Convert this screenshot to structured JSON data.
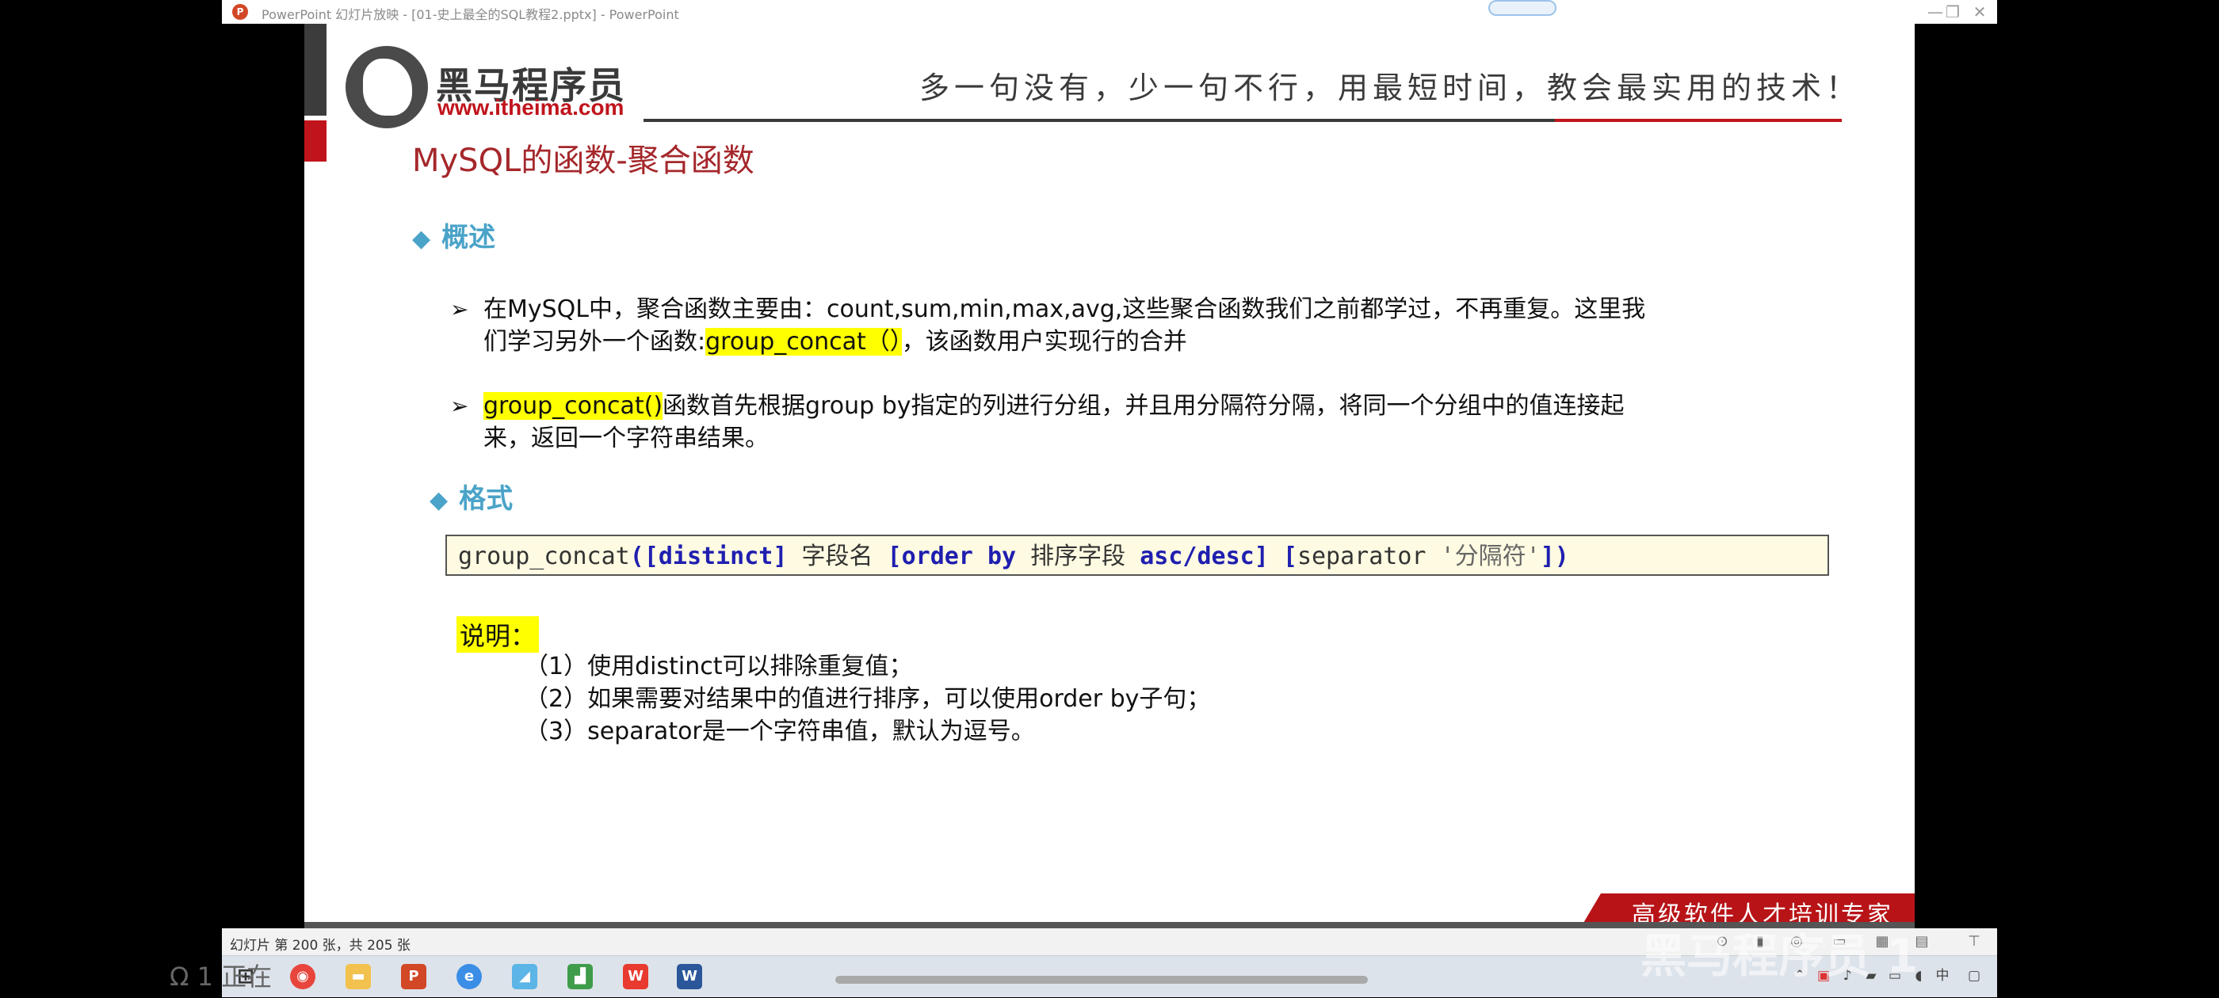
{
  "window": {
    "app_icon_letter": "P",
    "title": "PowerPoint 幻灯片放映 - [01-史上最全的SQL教程2.pptx] - PowerPoint",
    "minimize": "—",
    "restore": "❐",
    "close": "✕"
  },
  "slide": {
    "logo": {
      "name": "黑马程序员",
      "url": "www.itheima.com"
    },
    "slogan": "多一句没有，少一句不行，用最短时间，教会最实用的技术！",
    "title": "MySQL的函数-聚合函数",
    "overview": {
      "diamond": "◆",
      "heading": "概述",
      "bullets": [
        {
          "arrow": "➢",
          "line1": "在MySQL中，聚合函数主要由：count,sum,min,max,avg,这些聚合函数我们之前都学过，不再重复。这里我",
          "line2_prefix": "们学习另外一个函数:",
          "line2_highlight": "group_concat（）",
          "line2_suffix": "，该函数用户实现行的合并"
        },
        {
          "arrow": "➢",
          "highlight": "group_concat()",
          "line1_suffix": "函数首先根据group by指定的列进行分组，并且用分隔符分隔，将同一个分组中的值连接起",
          "line2": "来，返回一个字符串结果。"
        }
      ]
    },
    "format": {
      "diamond": "◆",
      "heading": "格式",
      "code": {
        "fn": "group_concat",
        "open": "([",
        "distinct": "distinct",
        "close1": "]",
        "field": " 字段名 ",
        "lb": "[",
        "order_by": "order by",
        "sort_field": " 排序字段 ",
        "asc_desc": "asc/desc",
        "close2": "]",
        "lb2": "[",
        "separator": "separator ",
        "sep_value": "'分隔符'",
        "end": "])"
      }
    },
    "notes": {
      "label": "说明：",
      "items": [
        "（1）使用distinct可以排除重复值；",
        "（2）如果需要对结果中的值进行排序，可以使用order by子句；",
        "（3）separator是一个字符串值，默认为逗号。"
      ]
    },
    "banner": "高级软件人才培训专家"
  },
  "statusbar": {
    "slide_info": "幻灯片 第 200 张，共 205 张"
  },
  "overlay": {
    "left_text": "Ω 1  正在",
    "right_text": "黑马程序员 1"
  },
  "colors": {
    "title_red": "#a5272b",
    "section_blue": "#4aa3c8",
    "highlight_yellow": "#ffff00",
    "keyword_blue": "#1f1fb0",
    "brand_red": "#c0141c"
  }
}
